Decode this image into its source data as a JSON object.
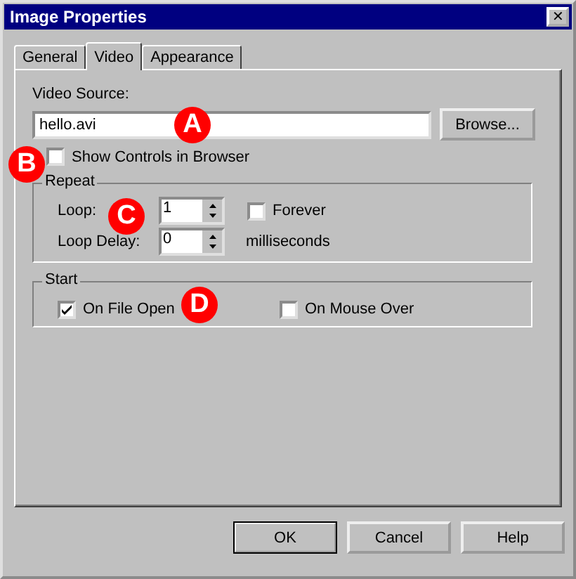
{
  "window": {
    "title": "Image Properties",
    "close_symbol": "✕"
  },
  "tabs": [
    {
      "label": "General",
      "selected": false
    },
    {
      "label": "Video",
      "selected": true
    },
    {
      "label": "Appearance",
      "selected": false
    }
  ],
  "video_source": {
    "label": "Video Source:",
    "value": "hello.avi",
    "browse_button": "Browse..."
  },
  "show_controls": {
    "label": "Show Controls in Browser",
    "checked": false
  },
  "repeat": {
    "title": "Repeat",
    "loop_label": "Loop:",
    "loop_value": "1",
    "forever": {
      "label": "Forever",
      "checked": false
    },
    "delay_label": "Loop Delay:",
    "delay_value": "0",
    "delay_unit": "milliseconds"
  },
  "start": {
    "title": "Start",
    "options": [
      {
        "label": "On File Open",
        "checked": true
      },
      {
        "label": "On Mouse Over",
        "checked": false
      }
    ]
  },
  "buttons": [
    {
      "label": "OK",
      "default": true
    },
    {
      "label": "Cancel",
      "default": false
    },
    {
      "label": "Help",
      "default": false
    }
  ],
  "callouts": [
    "A",
    "B",
    "C",
    "D"
  ]
}
